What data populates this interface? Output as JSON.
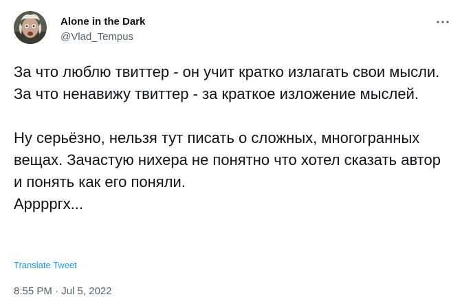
{
  "author": {
    "display_name": "Alone in the Dark",
    "handle": "@Vlad_Tempus",
    "avatar_icon": "avatar-photo"
  },
  "more_icon": "more-options-icon",
  "tweet": {
    "text": "За что люблю твиттер - он учит кратко излагать свои мысли.\nЗа что ненавижу твиттер - за краткое изложение мыслей.\n\nНу серьёзно, нельзя тут писать о сложных, многогранных вещах. Зачастую нихера не понятно что хотел сказать автор и понять как его поняли.\nАрррргх...",
    "translate_label": "Translate Tweet",
    "time": "8:55 PM",
    "separator": "·",
    "date": "Jul 5, 2022"
  },
  "colors": {
    "text": "#0f1419",
    "secondary": "#536471",
    "link": "#1d9bf0"
  }
}
